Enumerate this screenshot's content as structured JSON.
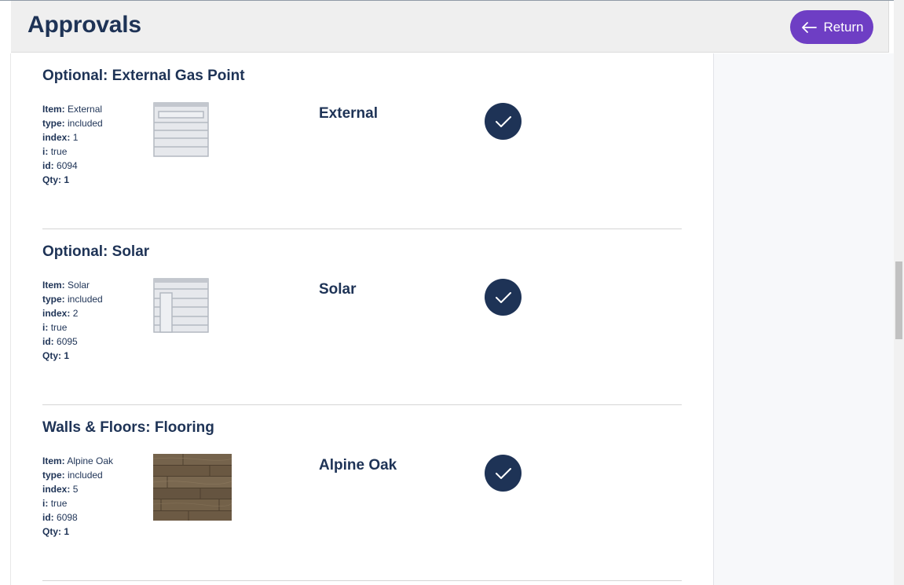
{
  "header": {
    "title": "Approvals",
    "return_label": "Return"
  },
  "colors": {
    "primary": "#1e3356",
    "accent": "#6e3ec4",
    "header_bg": "#efefef"
  },
  "labels": {
    "item": "Item:",
    "type": "type:",
    "index": "index:",
    "i": "i:",
    "id": "id:",
    "qty": "Qty:"
  },
  "sections": [
    {
      "title": "Optional: External Gas Point",
      "item": "External",
      "type": "included",
      "index": "1",
      "i": "true",
      "id": "6094",
      "qty": "1",
      "name": "External",
      "thumbnail_icon": "external-gas-point-icon",
      "approved": true
    },
    {
      "title": "Optional: Solar",
      "item": "Solar",
      "type": "included",
      "index": "2",
      "i": "true",
      "id": "6095",
      "qty": "1",
      "name": "Solar",
      "thumbnail_icon": "solar-panel-icon",
      "approved": true
    },
    {
      "title": "Walls & Floors: Flooring",
      "item": "Alpine Oak",
      "type": "included",
      "index": "5",
      "i": "true",
      "id": "6098",
      "qty": "1",
      "name": "Alpine Oak",
      "thumbnail_icon": "wood-flooring-swatch",
      "approved": true
    }
  ]
}
